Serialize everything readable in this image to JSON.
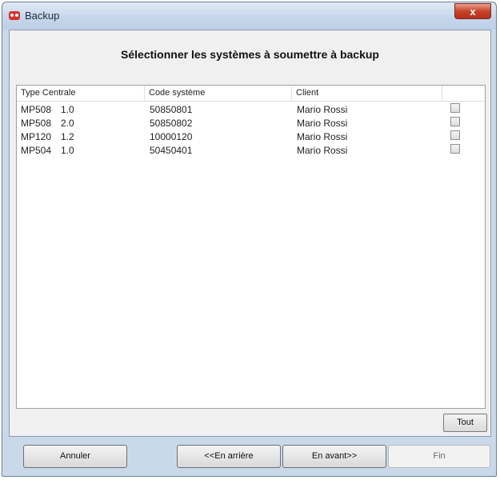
{
  "window": {
    "title": "Backup",
    "close_label": "x"
  },
  "header": {
    "title": "Sélectionner les systèmes à soumettre à backup"
  },
  "table": {
    "columns": [
      "Type Centrale",
      "Code système",
      "Client",
      ""
    ],
    "rows": [
      {
        "model": "MP508",
        "version": "1.0",
        "code": "50850801",
        "client": "Mario Rossi",
        "checked": false
      },
      {
        "model": "MP508",
        "version": "2.0",
        "code": "50850802",
        "client": "Mario Rossi",
        "checked": false
      },
      {
        "model": "MP120",
        "version": "1.2",
        "code": "10000120",
        "client": "Mario Rossi",
        "checked": false
      },
      {
        "model": "MP504",
        "version": "1.0",
        "code": "50450401",
        "client": "Mario Rossi",
        "checked": false
      }
    ]
  },
  "buttons": {
    "all": "Tout",
    "cancel": "Annuler",
    "back": "<<En arrière",
    "next": "En avant>>",
    "finish": "Fin"
  },
  "colors": {
    "frame": "#c9d9ea",
    "close": "#c7432b",
    "content_bg": "#f0f0f0"
  }
}
